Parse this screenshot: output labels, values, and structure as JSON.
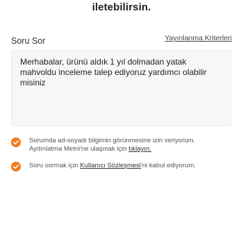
{
  "header": {
    "subtitle": "iletebilirsin."
  },
  "question": {
    "label": "Soru Sor",
    "criteria_link": "Yayınlanma Kriterleri",
    "text": "Merhabalar, ürünü aldık 1 yıl dolmadan yatak mahvoldu inceleme talep ediyoruz yardımcı olabilir misiniz"
  },
  "consents": [
    {
      "line1": "Sorumda ad-soyadı bilgimin görünmesine izin veriyorum.",
      "line2_prefix": "Aydınlatma Metni'ne ulaşmak için ",
      "link": "tıklayın."
    },
    {
      "prefix": "Soru sormak için ",
      "link": "Kullanıcı Sözleşmesi",
      "suffix": "'ni kabul ediyorum."
    }
  ],
  "colors": {
    "check_accent": "#f27a1a"
  }
}
